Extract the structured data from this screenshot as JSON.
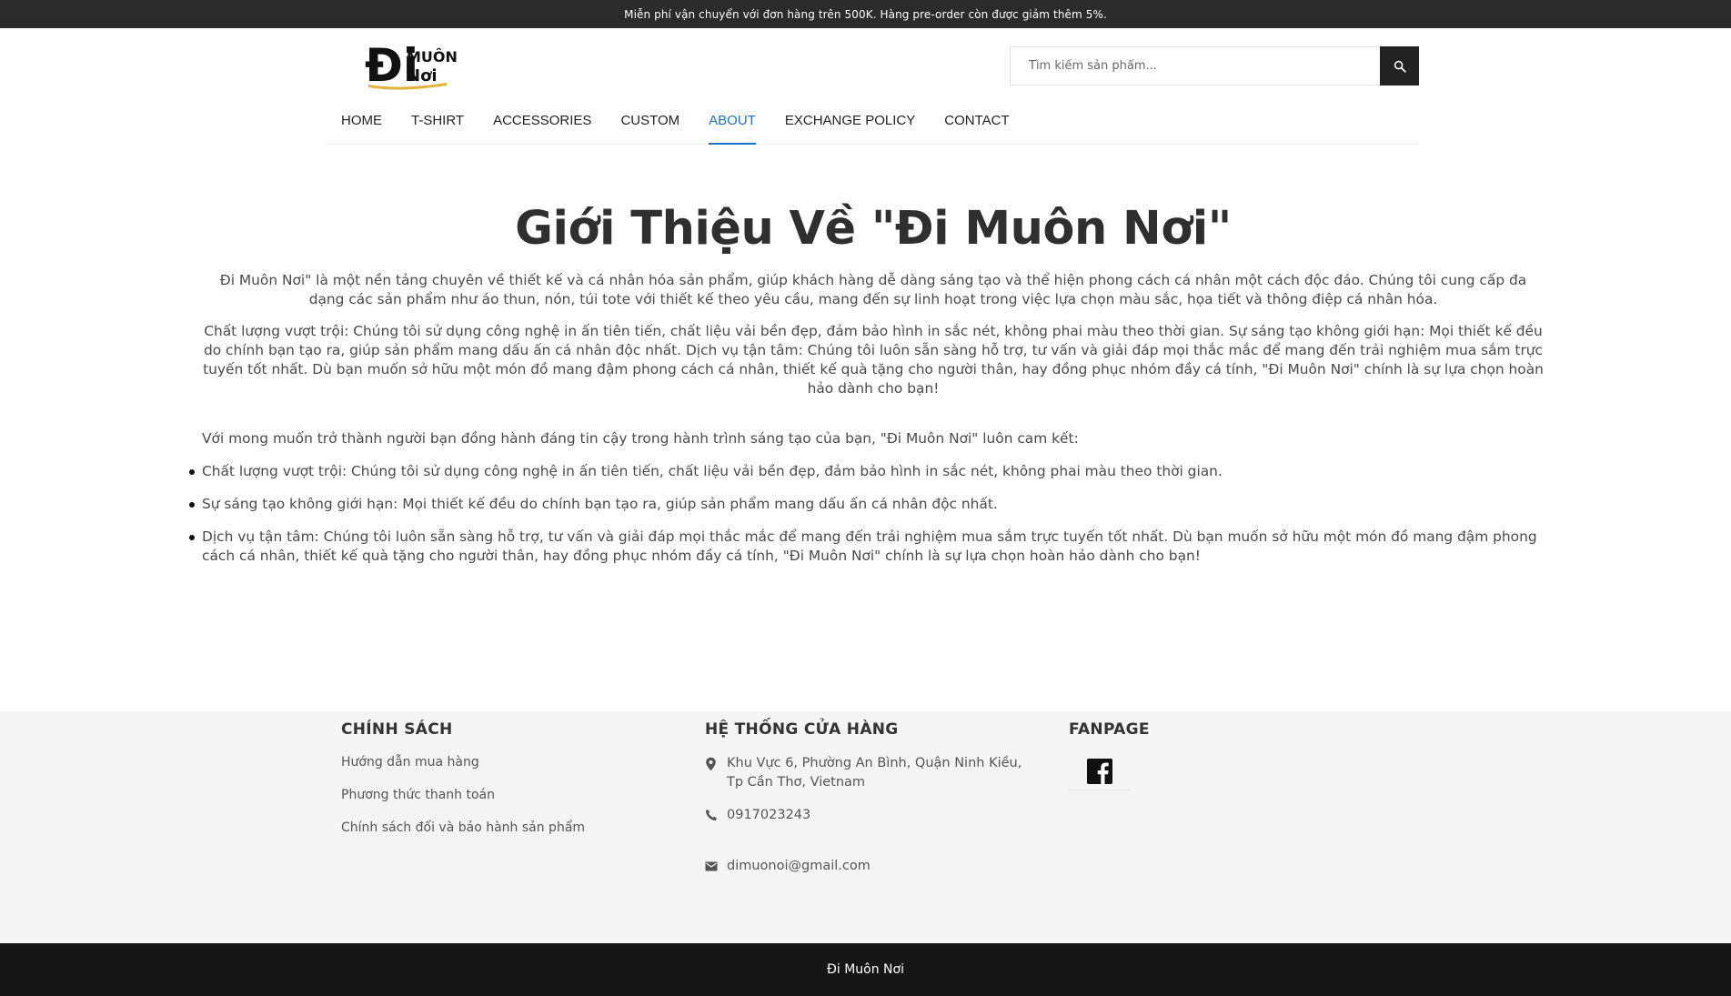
{
  "topbar": {
    "text": "Miễn phí vận chuyển với đơn hàng trên 500K. Hàng pre-order còn được giảm thêm 5%."
  },
  "brand": {
    "logo_text_main": "Đi",
    "logo_text_top": "MUÔN",
    "logo_text_bottom": "Nơi",
    "logo_accent": "#e2b33a"
  },
  "search": {
    "placeholder": "Tìm kiếm sản phẩm...",
    "icon": "search-icon"
  },
  "nav": {
    "items": [
      {
        "label": "HOME"
      },
      {
        "label": "T-SHIRT"
      },
      {
        "label": "ACCESSORIES"
      },
      {
        "label": "CUSTOM"
      },
      {
        "label": "ABOUT",
        "active": true
      },
      {
        "label": "EXCHANGE POLICY"
      },
      {
        "label": "CONTACT"
      }
    ],
    "active_color": "#1a73c7"
  },
  "main": {
    "title": "Giới Thiệu Về \"Đi Muôn Nơi\"",
    "intro": "Đi Muôn Nơi\" là một nền tảng chuyên về thiết kế và cá nhân hóa sản phẩm, giúp khách hàng dễ dàng sáng tạo và thể hiện phong cách cá nhân một cách độc đáo. Chúng tôi cung cấp đa dạng các sản phẩm như áo thun, nón, túi tote với thiết kế theo yêu cầu, mang đến sự linh hoạt trong việc lựa chọn màu sắc, họa tiết và thông điệp cá nhân hóa.",
    "summary": "Chất lượng vượt trội: Chúng tôi sử dụng công nghệ in ấn tiên tiến, chất liệu vải bền đẹp, đảm bảo hình in sắc nét, không phai màu theo thời gian. Sự sáng tạo không giới hạn: Mọi thiết kế đều do chính bạn tạo ra, giúp sản phẩm mang dấu ấn cá nhân độc nhất. Dịch vụ tận tâm: Chúng tôi luôn sẵn sàng hỗ trợ, tư vấn và giải đáp mọi thắc mắc để mang đến trải nghiệm mua sắm trực tuyến tốt nhất. Dù bạn muốn sở hữu một món đồ mang đậm phong cách cá nhân, thiết kế quà tặng cho người thân, hay đồng phục nhóm đầy cá tính, \"Đi Muôn Nơi\" chính là sự lựa chọn hoàn hảo dành cho bạn!",
    "commit_intro": "Với mong muốn trở thành người bạn đồng hành đáng tin cậy trong hành trình sáng tạo của bạn, \"Đi Muôn Nơi\" luôn cam kết:",
    "commitments": [
      "Chất lượng vượt trội: Chúng tôi sử dụng công nghệ in ấn tiên tiến, chất liệu vải bền đẹp, đảm bảo hình in sắc nét, không phai màu theo thời gian.",
      "Sự sáng tạo không giới hạn: Mọi thiết kế đều do chính bạn tạo ra, giúp sản phẩm mang dấu ấn cá nhân độc nhất.",
      "Dịch vụ tận tâm: Chúng tôi luôn sẵn sàng hỗ trợ, tư vấn và giải đáp mọi thắc mắc để mang đến trải nghiệm mua sắm trực tuyến tốt nhất. Dù bạn muốn sở hữu một món đồ mang đậm phong cách cá nhân, thiết kế quà tặng cho người thân, hay đồng phục nhóm đầy cá tính, \"Đi Muôn Nơi\" chính là sự lựa chọn hoàn hảo dành cho bạn!"
    ]
  },
  "footer": {
    "policy": {
      "heading": "CHÍNH SÁCH",
      "links": [
        "Hướng dẫn mua hàng",
        "Phương thức thanh toán",
        "Chính sách đổi và bảo hành sản phẩm"
      ]
    },
    "stores": {
      "heading": "HỆ THỐNG CỬA HÀNG",
      "address": "Khu Vực 6, Phường An Bình, Quận Ninh Kiều, Tp Cần Thơ, Vietnam",
      "phone": "0917023243",
      "email": "dimuonoi@gmail.com",
      "icons": [
        "location-pin-icon",
        "phone-icon",
        "mail-icon"
      ]
    },
    "fanpage": {
      "heading": "FANPAGE",
      "icon": "facebook-icon"
    }
  },
  "bottom": {
    "copyright": "Đi Muôn Nơi"
  }
}
